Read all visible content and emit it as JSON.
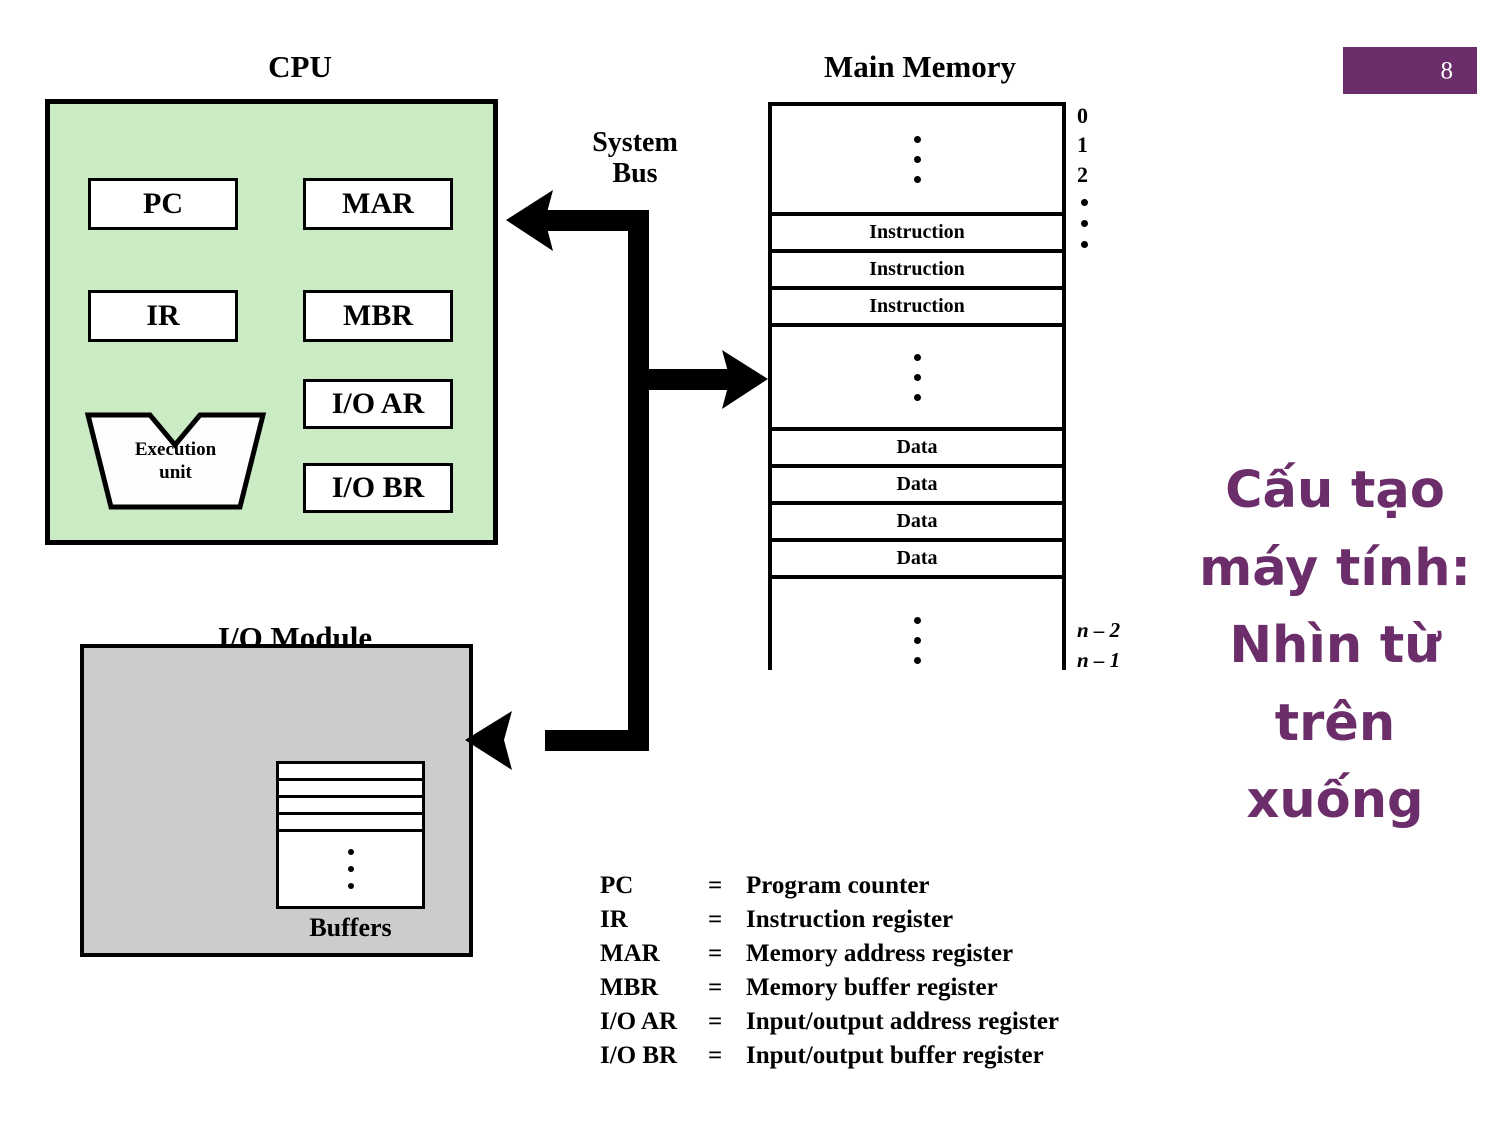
{
  "slide": {
    "number": "8",
    "badge_color": "#6B2E6B"
  },
  "vietnamese_title": {
    "lines": [
      "Cấu tạo",
      "máy tính:",
      "Nhìn từ",
      "trên",
      "xuống"
    ],
    "color": "#6B2E6B"
  },
  "cpu": {
    "caption": "CPU",
    "fill_color": "#CBEBC5",
    "registers": [
      {
        "label": "PC"
      },
      {
        "label": "IR"
      },
      {
        "label": "MAR"
      },
      {
        "label": "MBR"
      },
      {
        "label": "I/O AR"
      },
      {
        "label": "I/O BR"
      }
    ],
    "execution_unit": {
      "line1": "Execution",
      "line2": "unit"
    }
  },
  "bus": {
    "caption_line1": "System",
    "caption_line2": "Bus"
  },
  "memory": {
    "caption": "Main Memory",
    "cells": [
      {
        "type": "dots",
        "label": ""
      },
      {
        "type": "row",
        "label": "Instruction"
      },
      {
        "type": "row",
        "label": "Instruction"
      },
      {
        "type": "row",
        "label": "Instruction"
      },
      {
        "type": "dots",
        "label": ""
      },
      {
        "type": "row",
        "label": "Data"
      },
      {
        "type": "row",
        "label": "Data"
      },
      {
        "type": "row",
        "label": "Data"
      },
      {
        "type": "row",
        "label": "Data"
      },
      {
        "type": "dots",
        "label": ""
      }
    ],
    "addresses_top": [
      "0",
      "1",
      "2"
    ],
    "addresses_bottom": [
      "n – 2",
      "n – 1"
    ]
  },
  "io_module": {
    "caption": "I/O Module",
    "fill_color": "#CCCCCC",
    "buffers_label": "Buffers"
  },
  "legend": {
    "rows": [
      {
        "abbr": "PC",
        "eq": "=",
        "desc": "Program counter"
      },
      {
        "abbr": "IR",
        "eq": "=",
        "desc": "Instruction register"
      },
      {
        "abbr": "MAR",
        "eq": "=",
        "desc": "Memory address register"
      },
      {
        "abbr": "MBR",
        "eq": "=",
        "desc": "Memory buffer register"
      },
      {
        "abbr": "I/O AR",
        "eq": "=",
        "desc": "Input/output address register"
      },
      {
        "abbr": "I/O BR",
        "eq": "=",
        "desc": "Input/output buffer register"
      }
    ]
  }
}
